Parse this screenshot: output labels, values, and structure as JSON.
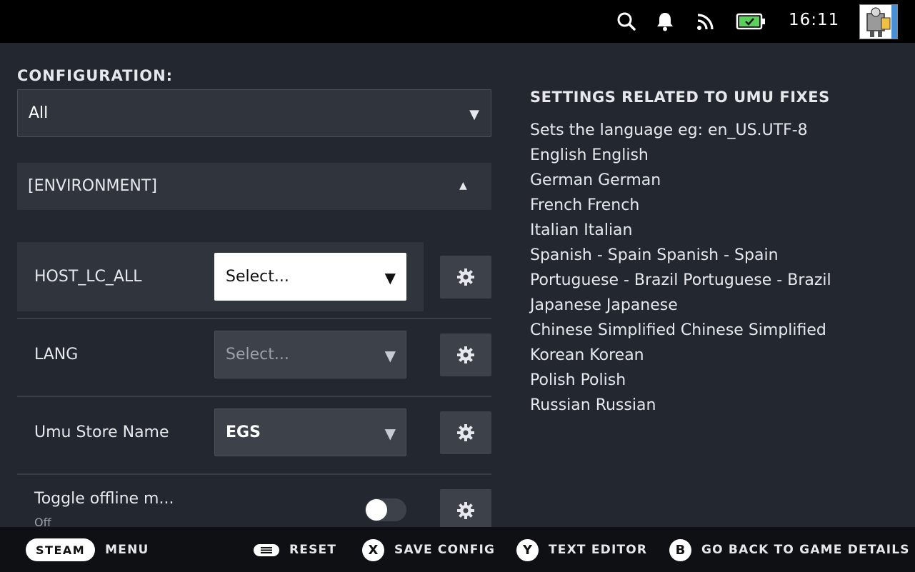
{
  "topbar": {
    "icons": [
      "search-icon",
      "bell-icon",
      "rss-icon",
      "battery-icon"
    ],
    "battery_color": "#5bd15b",
    "time": "16:11"
  },
  "left": {
    "config_label": "CONFIGURATION:",
    "config_value": "All",
    "section_header": "[ENVIRONMENT]",
    "rows": [
      {
        "label": "HOST_LC_ALL",
        "value": "Select..."
      },
      {
        "label": "LANG",
        "value": "Select..."
      },
      {
        "label": "Umu Store Name",
        "value": "EGS"
      },
      {
        "label": "Toggle offline m...",
        "sublabel": "Off",
        "toggle_on": false
      }
    ]
  },
  "right": {
    "title": "SETTINGS RELATED TO UMU FIXES",
    "lines": [
      "Sets the language eg: en_US.UTF-8",
      "English English",
      "German German",
      "French French",
      "Italian Italian",
      "Spanish - Spain Spanish - Spain",
      "Portuguese - Brazil Portuguese - Brazil",
      "Japanese Japanese",
      "Chinese Simplified Chinese Simplified",
      "Korean Korean",
      "Polish Polish",
      "Russian Russian"
    ]
  },
  "footer": {
    "steam": "STEAM",
    "menu": "MENU",
    "reset": "RESET",
    "save_key": "X",
    "save": "SAVE CONFIG",
    "text_key": "Y",
    "text_editor": "TEXT EDITOR",
    "back_key": "B",
    "back": "GO BACK TO GAME DETAILS"
  }
}
